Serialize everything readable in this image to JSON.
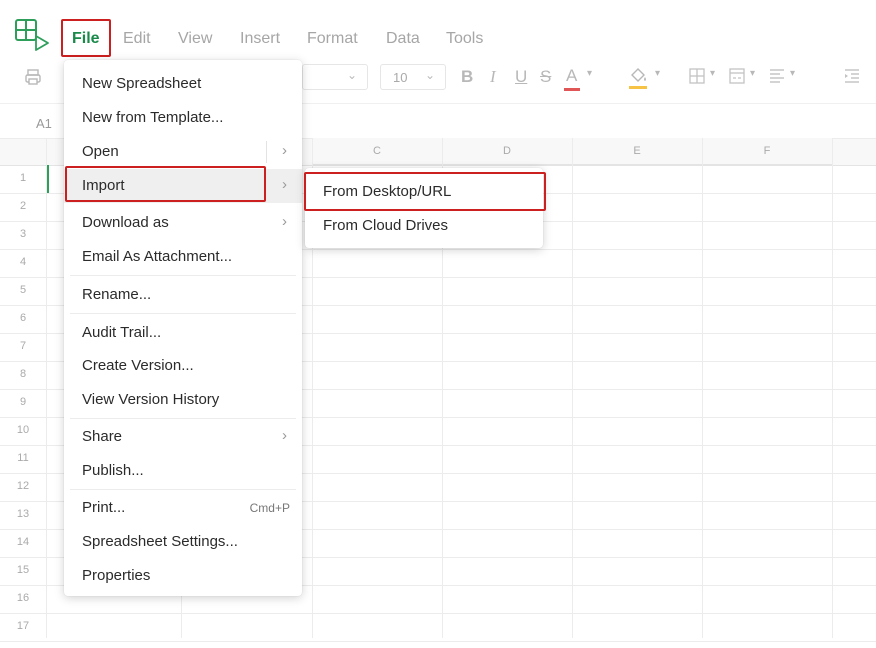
{
  "menubar": {
    "items": [
      "File",
      "Edit",
      "View",
      "Insert",
      "Format",
      "Data",
      "Tools"
    ]
  },
  "toolbar": {
    "font_size": "10",
    "bold_label": "B",
    "italic_label": "I",
    "underline_label": "U",
    "strikethrough_label": "S",
    "font_color_label": "A",
    "font_color": "#e05555",
    "fill_color": "#f6c344"
  },
  "sheet": {
    "cell_ref": "A1",
    "columns": [
      "C",
      "D",
      "E",
      "F"
    ],
    "rows": [
      "1",
      "2",
      "3",
      "4",
      "5",
      "6",
      "7",
      "8",
      "9",
      "10",
      "11",
      "12",
      "13",
      "14",
      "15",
      "16",
      "17"
    ]
  },
  "file_menu": {
    "items": [
      {
        "label": "New Spreadsheet"
      },
      {
        "label": "New from Template..."
      },
      {
        "label": "Open",
        "submenu": true
      },
      {
        "label": "Import",
        "submenu": true
      },
      {
        "label": "Download as",
        "submenu": true
      },
      {
        "label": "Email As Attachment..."
      },
      {
        "label": "Rename..."
      },
      {
        "label": "Audit Trail..."
      },
      {
        "label": "Create Version..."
      },
      {
        "label": "View Version History"
      },
      {
        "label": "Share",
        "submenu": true
      },
      {
        "label": "Publish..."
      },
      {
        "label": "Print...",
        "shortcut": "Cmd+P"
      },
      {
        "label": "Spreadsheet Settings..."
      },
      {
        "label": "Properties"
      }
    ]
  },
  "import_submenu": {
    "items": [
      "From Desktop/URL",
      "From Cloud Drives"
    ]
  },
  "colors": {
    "brand_green": "#1a8a4a",
    "highlight_red": "#cc1f1f"
  }
}
